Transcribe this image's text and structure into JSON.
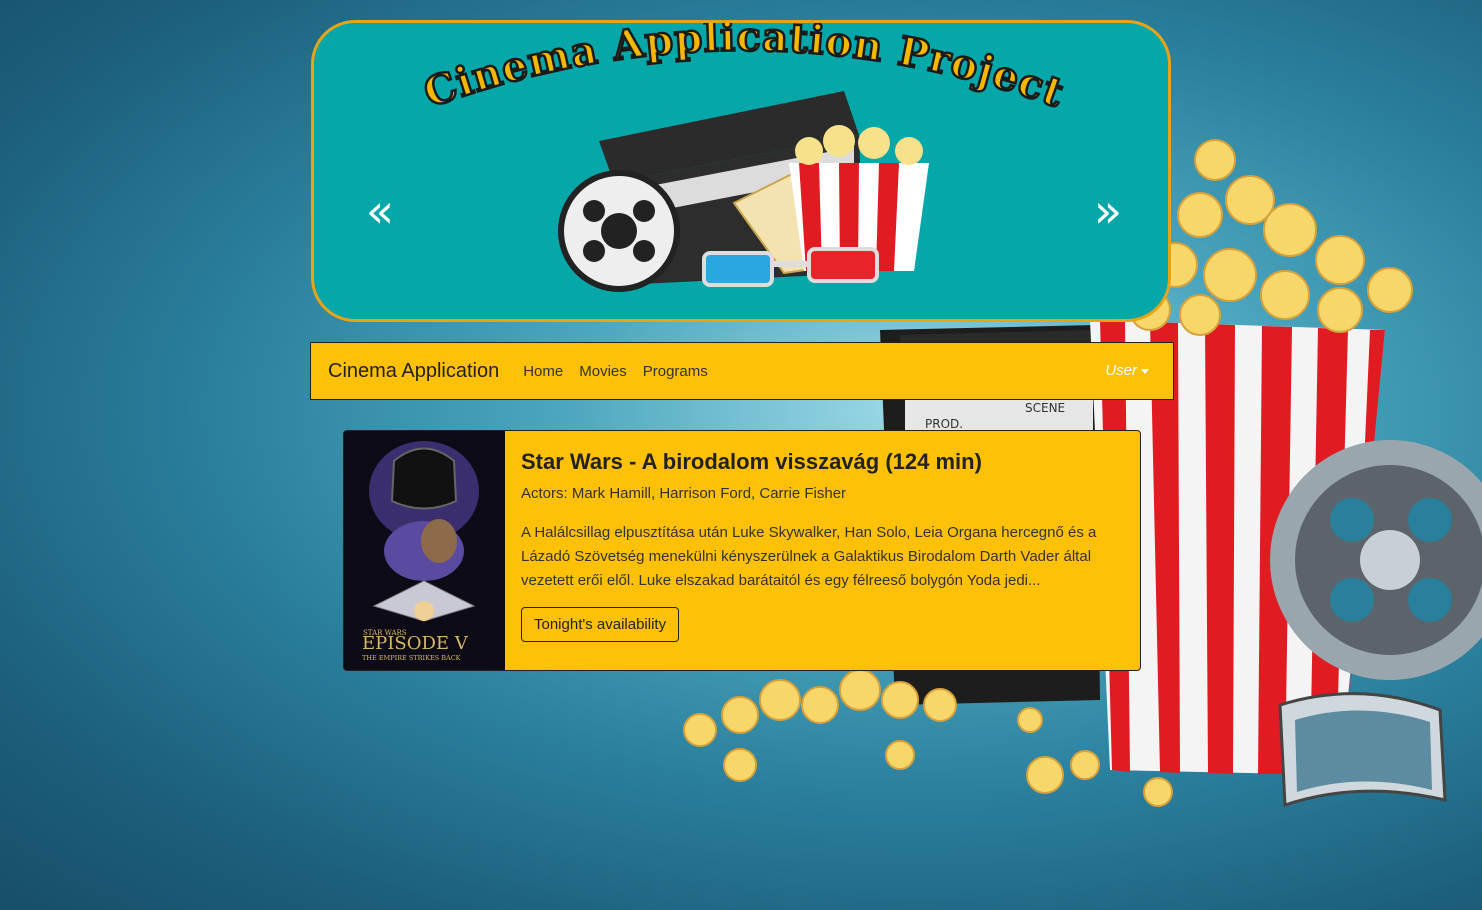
{
  "banner": {
    "title": "Cinema Application Project",
    "prev_glyph": "«",
    "next_glyph": "»"
  },
  "navbar": {
    "brand": "Cinema Application",
    "links": [
      "Home",
      "Movies",
      "Programs"
    ],
    "user": "User"
  },
  "movie": {
    "title": "Star Wars - A birodalom visszavág (124 min)",
    "actors": "Actors: Mark Hamill, Harrison Ford, Carrie Fisher",
    "description": "A Halálcsillag elpusztítása után Luke Skywalker, Han Solo, Leia Organa hercegnő és a Lázadó Szövetség menekülni kényszerülnek a Galaktikus Birodalom Darth Vader által vezetett erői elől. Luke elszakad barátaitól és egy félreeső bolygón Yoda jedi...",
    "availability_button": "Tonight's availability",
    "poster": {
      "brand": "STAR WARS",
      "episode": "EPISODE V",
      "subtitle": "THE EMPIRE STRIKES BACK"
    }
  },
  "colors": {
    "accent": "#ffc107",
    "banner_bg": "#05a7a9",
    "banner_border": "#e8a317"
  }
}
